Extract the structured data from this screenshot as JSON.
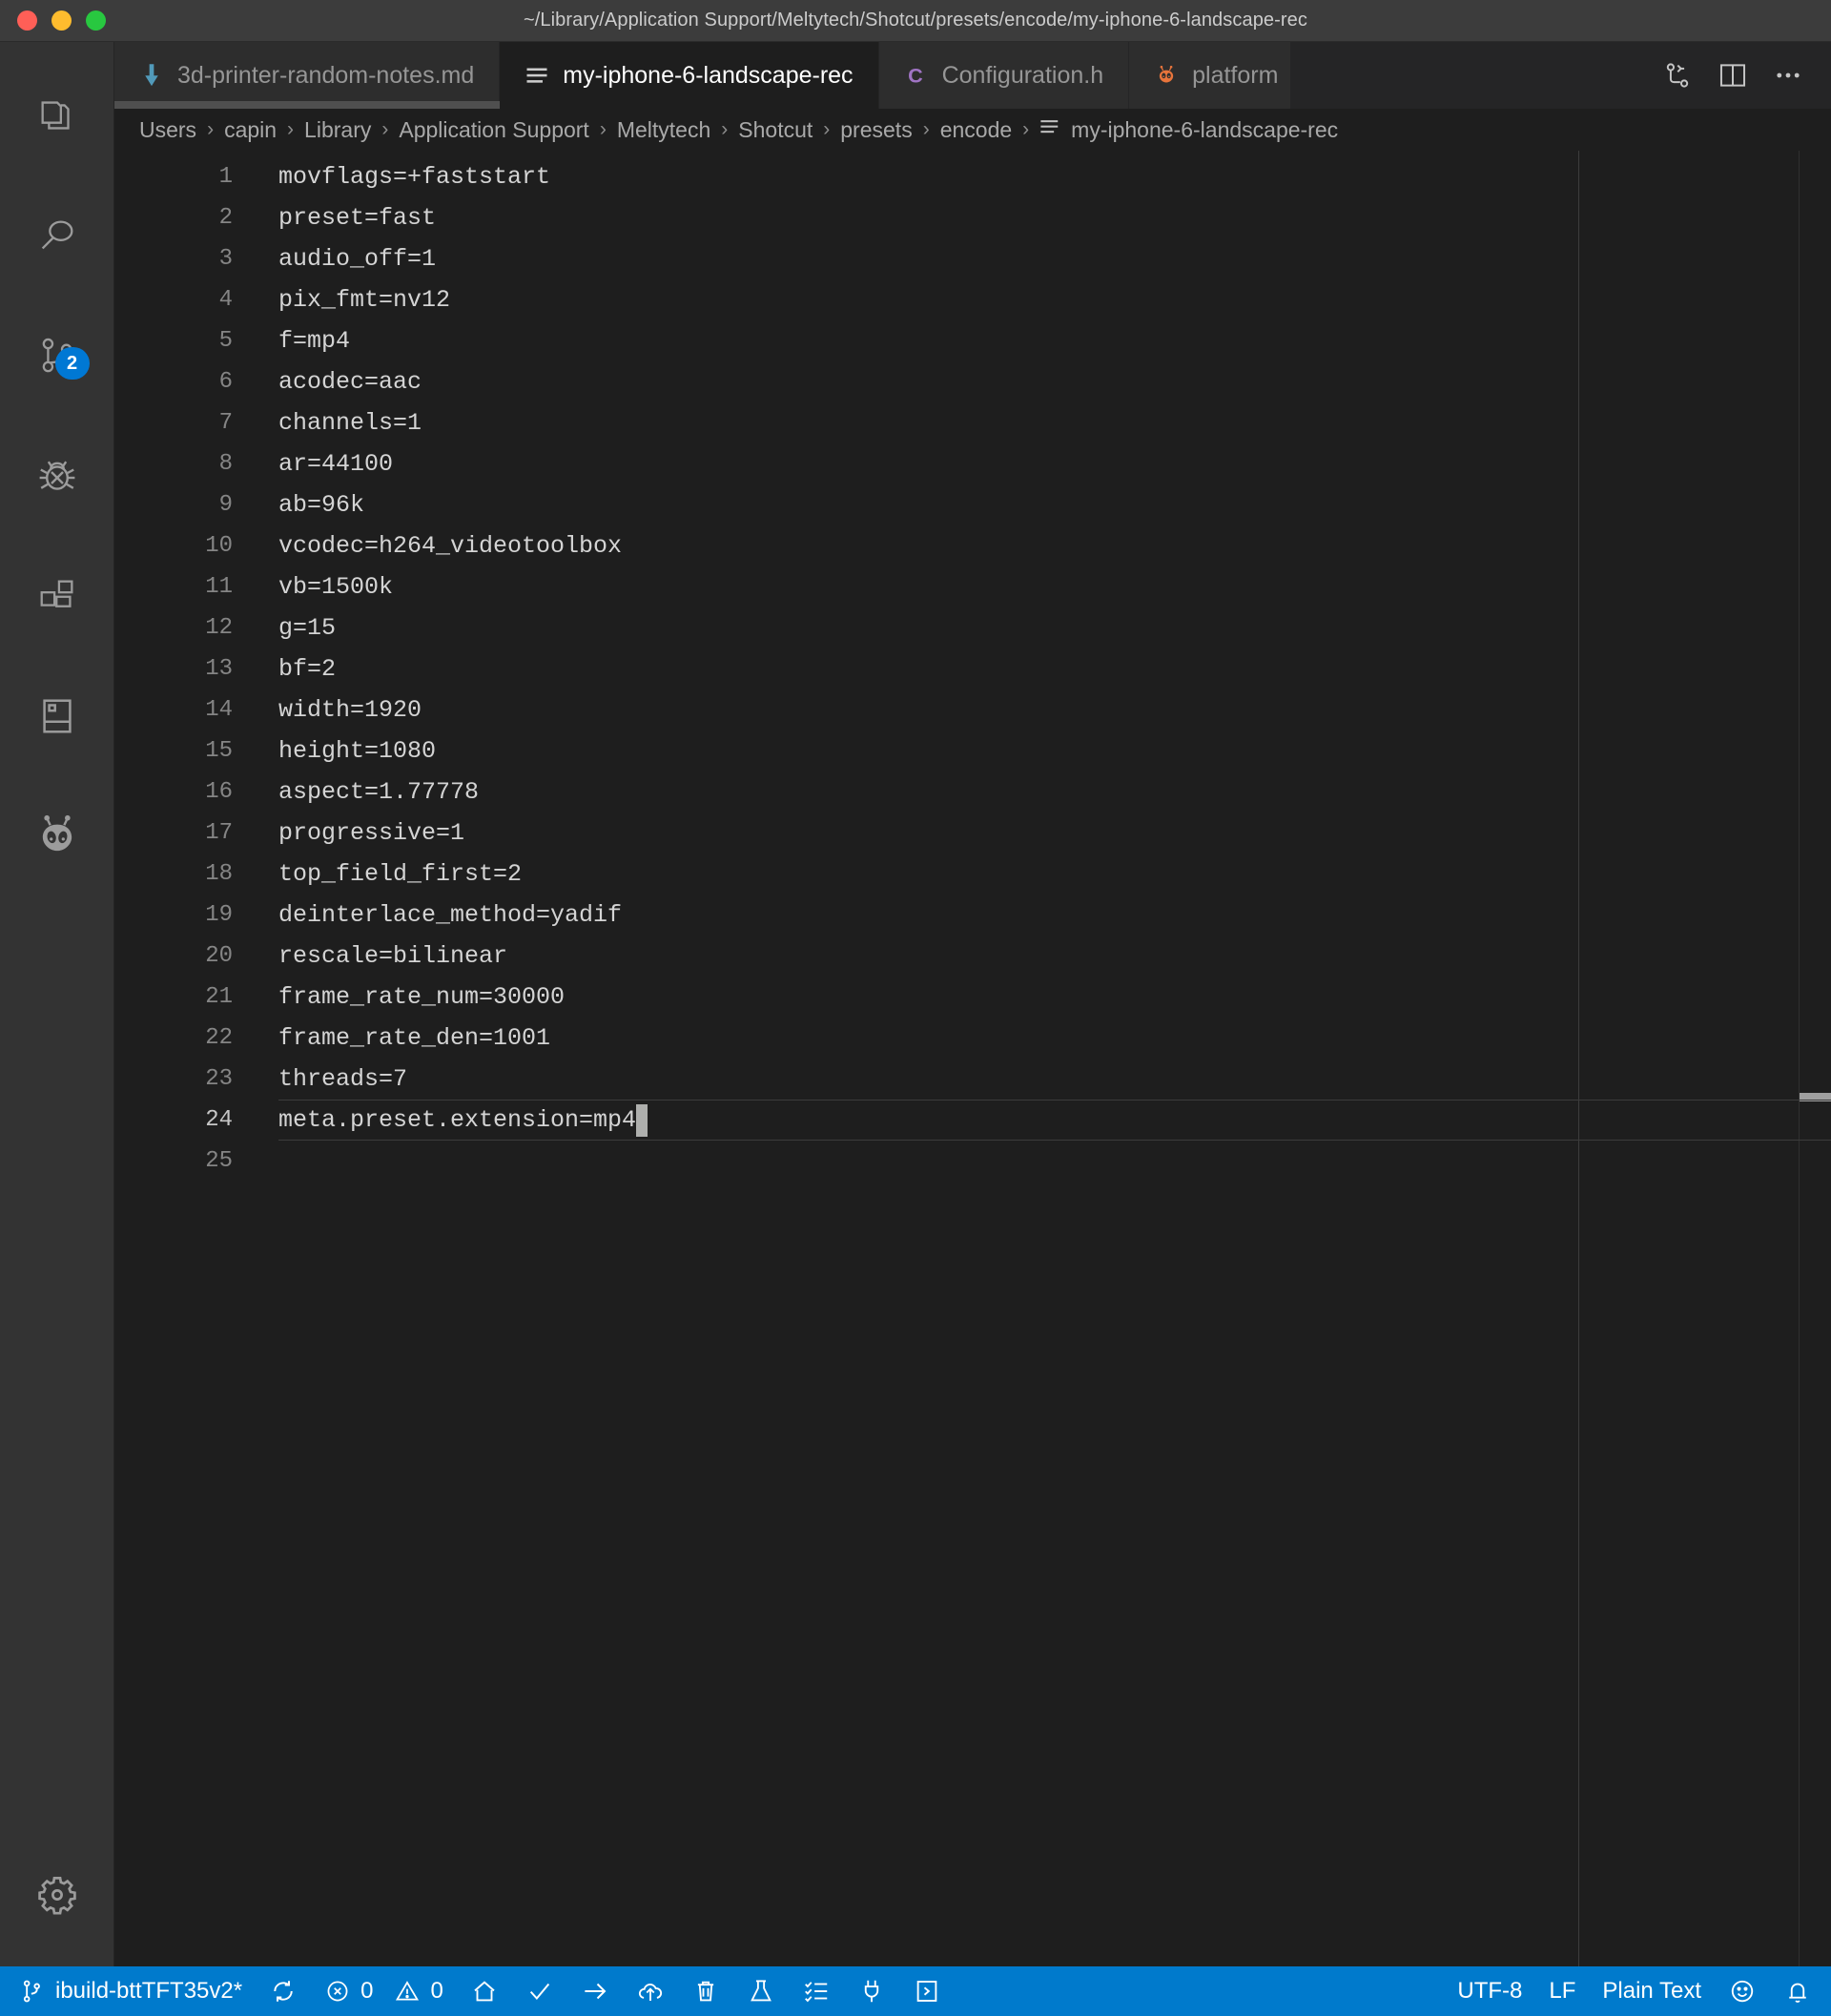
{
  "window": {
    "title": "~/Library/Application Support/Meltytech/Shotcut/presets/encode/my-iphone-6-landscape-rec",
    "traffic_lights": [
      "close",
      "minimize",
      "maximize"
    ],
    "colors": {
      "close": "#ff5f57",
      "minimize": "#febc2e",
      "maximize": "#28c840"
    }
  },
  "activity_bar": {
    "items": [
      {
        "name": "explorer",
        "icon": "files-icon",
        "active": false,
        "badge": null
      },
      {
        "name": "search",
        "icon": "search-icon",
        "active": false,
        "badge": null
      },
      {
        "name": "source-control",
        "icon": "source-control-icon",
        "active": false,
        "badge": "2"
      },
      {
        "name": "run-and-debug",
        "icon": "debug-icon",
        "active": false,
        "badge": null
      },
      {
        "name": "extensions",
        "icon": "extensions-icon",
        "active": false,
        "badge": null
      },
      {
        "name": "remote-explorer",
        "icon": "device-icon",
        "active": false,
        "badge": null
      },
      {
        "name": "platformio",
        "icon": "alien-icon",
        "active": false,
        "badge": null
      }
    ],
    "bottom_items": [
      {
        "name": "manage-settings",
        "icon": "gear-icon"
      }
    ],
    "badge_color": "#0078d4"
  },
  "tabs": [
    {
      "label": "3d-printer-random-notes.md",
      "icon": "markdown-down-arrow-icon",
      "icon_color": "#519aba",
      "active": false
    },
    {
      "label": "my-iphone-6-landscape-rec",
      "icon": "settings-lines-icon",
      "icon_color": "#cccccc",
      "active": true
    },
    {
      "label": "Configuration.h",
      "icon": "c-header-icon",
      "icon_color": "#a074c4",
      "active": false
    },
    {
      "label": "platform",
      "icon": "platformio-ant-icon",
      "icon_color": "#e8743b",
      "active": false
    }
  ],
  "tab_actions": [
    {
      "name": "split-editor-diff",
      "icon": "compare-changes-icon"
    },
    {
      "name": "split-editor-right",
      "icon": "split-editor-icon"
    },
    {
      "name": "more-actions",
      "icon": "ellipsis-icon"
    }
  ],
  "breadcrumbs": {
    "segments": [
      "Users",
      "capin",
      "Library",
      "Application Support",
      "Meltytech",
      "Shotcut",
      "presets",
      "encode"
    ],
    "file": "my-iphone-6-landscape-rec",
    "file_icon": "settings-lines-icon",
    "separator": "›"
  },
  "editor": {
    "language": "Plain Text",
    "active_line": 24,
    "cursor_column": 25,
    "lines": [
      {
        "n": 1,
        "text": "movflags=+faststart"
      },
      {
        "n": 2,
        "text": "preset=fast"
      },
      {
        "n": 3,
        "text": "audio_off=1"
      },
      {
        "n": 4,
        "text": "pix_fmt=nv12"
      },
      {
        "n": 5,
        "text": "f=mp4"
      },
      {
        "n": 6,
        "text": "acodec=aac"
      },
      {
        "n": 7,
        "text": "channels=1"
      },
      {
        "n": 8,
        "text": "ar=44100"
      },
      {
        "n": 9,
        "text": "ab=96k"
      },
      {
        "n": 10,
        "text": "vcodec=h264_videotoolbox"
      },
      {
        "n": 11,
        "text": "vb=1500k"
      },
      {
        "n": 12,
        "text": "g=15"
      },
      {
        "n": 13,
        "text": "bf=2"
      },
      {
        "n": 14,
        "text": "width=1920"
      },
      {
        "n": 15,
        "text": "height=1080"
      },
      {
        "n": 16,
        "text": "aspect=1.77778"
      },
      {
        "n": 17,
        "text": "progressive=1"
      },
      {
        "n": 18,
        "text": "top_field_first=2"
      },
      {
        "n": 19,
        "text": "deinterlace_method=yadif"
      },
      {
        "n": 20,
        "text": "rescale=bilinear"
      },
      {
        "n": 21,
        "text": "frame_rate_num=30000"
      },
      {
        "n": 22,
        "text": "frame_rate_den=1001"
      },
      {
        "n": 23,
        "text": "threads=7"
      },
      {
        "n": 24,
        "text": "meta.preset.extension=mp4"
      },
      {
        "n": 25,
        "text": ""
      }
    ]
  },
  "status_bar": {
    "background": "#007acc",
    "branch": "ibuild-bttTFT35v2*",
    "branch_icon": "source-control-branch-icon",
    "sync_icon": "sync-icon",
    "errors": "0",
    "warnings": "0",
    "error_icon": "error-circle-icon",
    "warning_icon": "warning-triangle-icon",
    "left_icons": [
      {
        "name": "pio-home",
        "icon": "home-icon"
      },
      {
        "name": "pio-build",
        "icon": "check-icon"
      },
      {
        "name": "pio-upload",
        "icon": "arrow-right-icon"
      },
      {
        "name": "pio-remote-upload",
        "icon": "cloud-upload-icon"
      },
      {
        "name": "pio-clean",
        "icon": "trash-icon"
      },
      {
        "name": "pio-test",
        "icon": "beaker-icon"
      },
      {
        "name": "pio-tasks",
        "icon": "checklist-icon"
      },
      {
        "name": "pio-serial-monitor",
        "icon": "plug-icon"
      },
      {
        "name": "pio-new-terminal",
        "icon": "terminal-icon"
      }
    ],
    "encoding": "UTF-8",
    "eol": "LF",
    "language_mode": "Plain Text",
    "feedback_icon": "smiley-icon",
    "notifications_icon": "bell-icon"
  }
}
